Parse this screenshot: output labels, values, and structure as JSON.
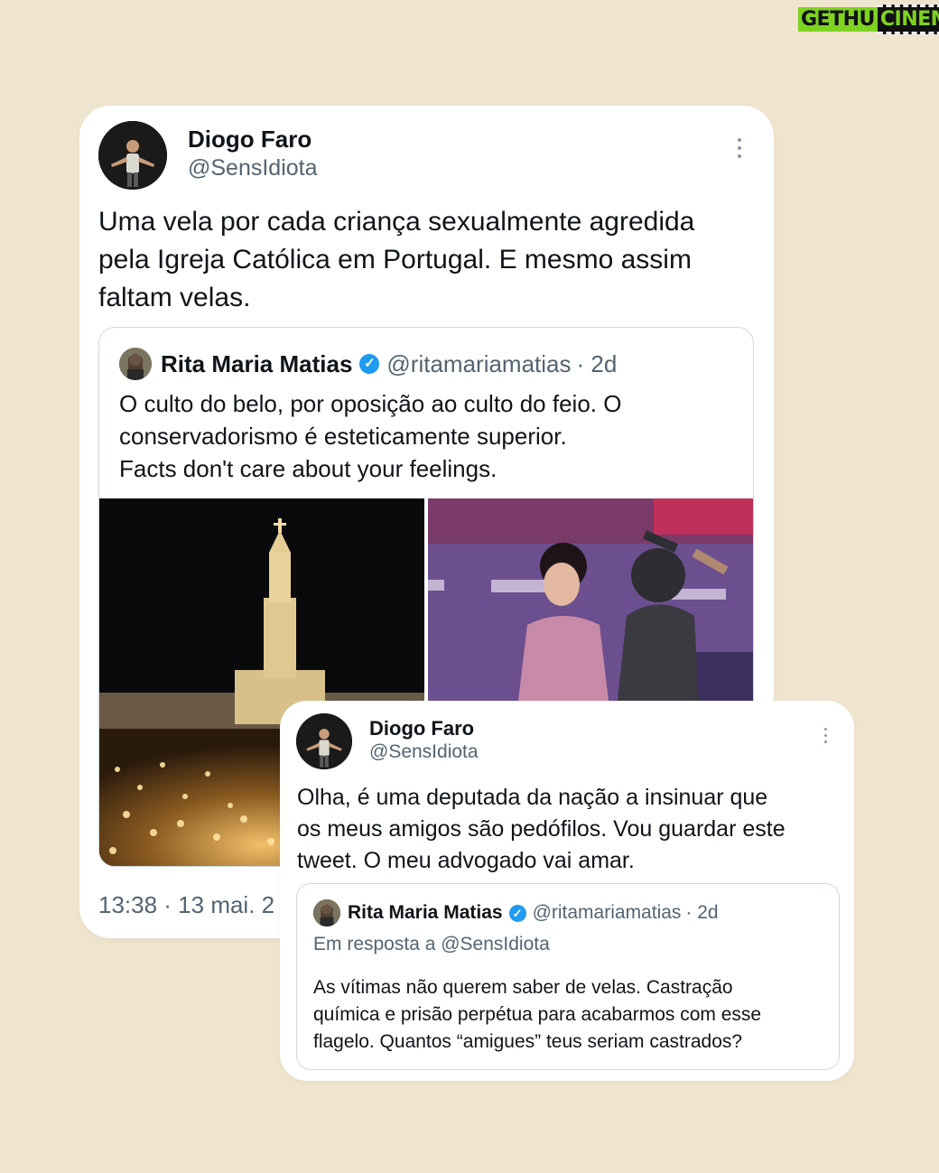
{
  "watermark": {
    "part1": "GETHU",
    "part2": "CINEMA"
  },
  "tweet1": {
    "author_name": "Diogo Faro",
    "author_handle": "@SensIdiota",
    "text_lines": [
      "Uma vela por cada criança sexualmente agredida",
      "pela Igreja Católica em Portugal. E mesmo assim",
      "faltam velas."
    ],
    "quoted": {
      "author_name": "Rita Maria Matias",
      "author_handle": "@ritamariamatias",
      "age": "· 2d",
      "text_lines": [
        "O culto do belo, por oposição ao culto do feio. O",
        "conservadorismo é esteticamente superior.",
        "Facts don't care about your feelings."
      ]
    },
    "timestamp": "13:38 · 13 mai. 2"
  },
  "tweet2": {
    "author_name": "Diogo Faro",
    "author_handle": "@SensIdiota",
    "text_lines": [
      "Olha, é uma deputada da nação a insinuar que",
      "os meus amigos são pedófilos. Vou guardar este",
      "tweet. O meu advogado vai amar."
    ],
    "quoted": {
      "author_name": "Rita Maria Matias",
      "author_handle": "@ritamariamatias",
      "age": "· 2d",
      "reply_to": "Em resposta a @SensIdiota",
      "text_lines": [
        "As vítimas não querem saber de velas. Castração",
        "química e prisão perpétua para acabarmos com esse",
        "flagelo. Quantos “amigues” teus seriam castrados?"
      ]
    }
  },
  "colors": {
    "background": "#efe4ce",
    "verified": "#1d9bf0",
    "secondary_text": "#536471"
  },
  "icons": [
    "more-options-icon",
    "verified-badge-icon"
  ]
}
